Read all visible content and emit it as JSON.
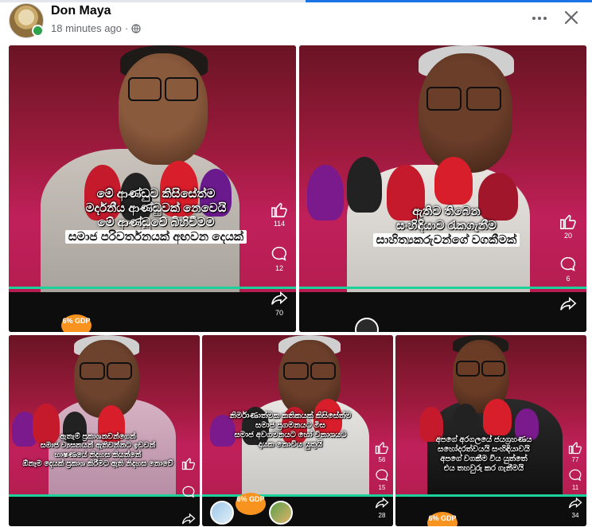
{
  "post": {
    "author": "Don Maya",
    "time": "18 minutes ago",
    "privacy_icon": "globe-icon"
  },
  "header_icons": {
    "more": "more-horizontal-icon",
    "close": "close-icon"
  },
  "tiles": [
    {
      "caption_lines": [
        "මේ ආණ්ඩුව කිසිසේත්ම",
        "මර්දනීය ආණ්ඩුවක් නෙවෙයි"
      ],
      "caption_hl": [
        "මේ ආණ්ඩුවේ බිහිවීමම",
        "සමාජ පරිවර්තනයක් අඟවන දෙයක්"
      ],
      "likes": "114",
      "comments": "12",
      "shares": "70",
      "badge": "6% GDP"
    },
    {
      "caption_lines": [
        "ඇතිව තිබෙන",
        "සංහිඳියාව රැකගැනීම"
      ],
      "caption_hl": [
        "සාහිත්‍යකරුවන්ගේ වගකීමක්"
      ],
      "likes": "20",
      "comments": "6",
      "shares": ""
    },
    {
      "caption_lines": [
        "ඇතැම් ප්‍රකාශනවන්ගෙන්",
        "සමාජ ව්‍යසනයන් ඇතිවන්නට ඉඩවන්",
        "භාෂණයේ නිදහස කියන්නේ",
        "ඕනෑම දෙයක් ප්‍රකාශ කිරීමට ඇති නිදහස නොවේ"
      ],
      "caption_hl": [],
      "likes": "",
      "comments": "",
      "shares": ""
    },
    {
      "caption_lines": [
        "නිර්මාණාත්මක කතිකයක් කිසිසේත්ම",
        "සමාජ ප්‍රගමනයට මිස",
        "සමාජ අවගමනයට හෝ විනාශයට",
        "දායක නොවිය යුතුයි"
      ],
      "caption_hl": [],
      "likes": "56",
      "comments": "15",
      "shares": "28",
      "badge": "6% GDP"
    },
    {
      "caption_lines": [
        "අපගේ අරගලයේ ජයග්‍රහණය",
        "සහෝදරත්වයයි සංහිඳියාවයි",
        "අපගේ වගකීම විය යුත්තේ",
        "එය තහවුරු කර ගැනීමයි"
      ],
      "caption_hl": [],
      "likes": "77",
      "comments": "11",
      "shares": "34",
      "badge": "6% GDP"
    }
  ],
  "colors": {
    "brand_blue": "#1b74e4",
    "tile_red": "#c0205a",
    "text_secondary": "#65676b"
  }
}
